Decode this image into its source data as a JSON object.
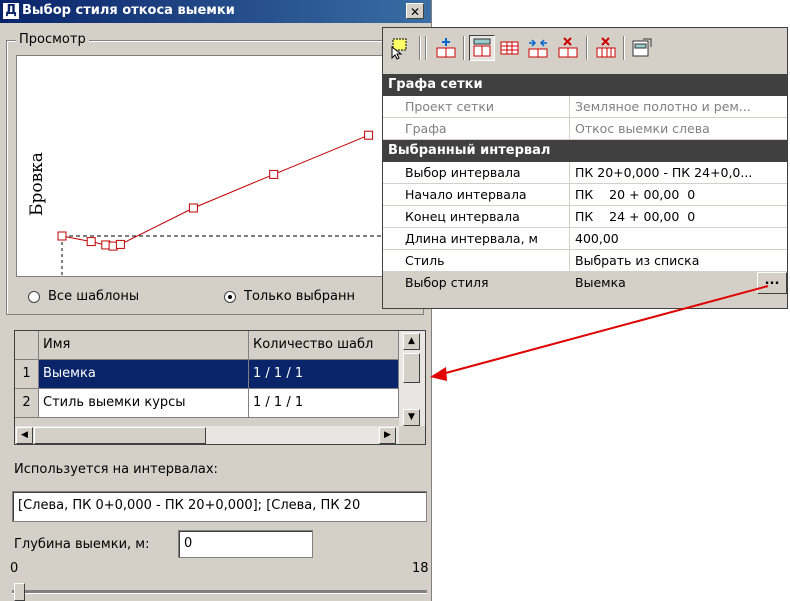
{
  "dialog": {
    "title_icon": "Д",
    "title": "Выбор стиля откоса выемки",
    "close_glyph": "✕",
    "preview_group_label": "Просмотр",
    "preview": {
      "axis_label": "Бровка",
      "chart_data": {
        "type": "line",
        "series": [
          {
            "points": [
              [
                0,
                0
              ],
              [
                4,
                -1
              ],
              [
                6,
                -1.6
              ],
              [
                7,
                -1.8
              ],
              [
                8,
                -1.5
              ],
              [
                18,
                5
              ],
              [
                29,
                11
              ],
              [
                42,
                18
              ]
            ],
            "color": "#c00000"
          }
        ],
        "baseline_y": 0
      }
    },
    "radio_all_label": "Все шаблоны",
    "radio_selected_label": "Только выбранн",
    "radio_selected_checked": true,
    "table": {
      "columns": [
        "Имя",
        "Количество шабл"
      ],
      "rows": [
        {
          "num": "1",
          "name": "Выемка",
          "count": "1 / 1 / 1",
          "selected": true
        },
        {
          "num": "2",
          "name": "Стиль выемки курсы",
          "count": "1 / 1 / 1",
          "selected": false
        }
      ]
    },
    "used_label": "Используется на интервалах:",
    "used_value": "[Слева, ПК 0+0,000 - ПК 20+0,000]; [Слева, ПК 20",
    "depth_label": "Глубина выемки, м:",
    "depth_value": "0",
    "slider_min": "0",
    "slider_max": "18",
    "slider_value_fraction": 0
  },
  "property_panel": {
    "toolbar_icons": [
      "select-icon",
      "add-row-icon",
      "grid-settings-icon",
      "table-icon",
      "split-interval-icon",
      "delete-interval-icon",
      "delete-all-icon",
      "export-icon"
    ],
    "categories": [
      {
        "title": "Графа сетки",
        "rows": [
          {
            "name": "Проект сетки",
            "value": "Земляное полотно и рем...",
            "disabled": true
          },
          {
            "name": "Графа",
            "value": "Откос выемки слева",
            "disabled": true
          }
        ]
      },
      {
        "title": "Выбранный интервал",
        "rows": [
          {
            "name": "Выбор интервала",
            "value": "ПК 20+0,000 - ПК 24+0,0..."
          },
          {
            "name": "Начало интервала",
            "value": "ПК    20 + 00,00  0"
          },
          {
            "name": "Конец интервала",
            "value": "ПК    24 + 00,00  0"
          },
          {
            "name": "Длина интервала, м",
            "value": "400,00"
          },
          {
            "name": "Стиль",
            "value": "Выбрать из списка"
          },
          {
            "name": "Выбор стиля",
            "value": "Выемка",
            "button": "..."
          }
        ]
      }
    ]
  },
  "colors": {
    "title_bar": "#0a246a",
    "selection": "#0a246a",
    "arrow": "#e00000",
    "chart_line": "#c00000"
  }
}
